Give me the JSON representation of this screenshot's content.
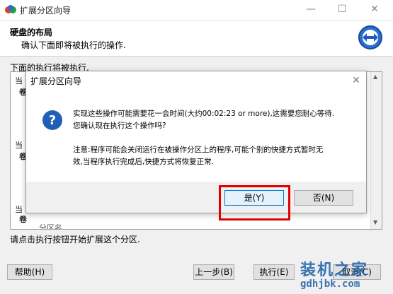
{
  "window": {
    "title": "扩展分区向导",
    "minimize": "—",
    "maximize": "☐",
    "close": "✕"
  },
  "header": {
    "title": "硬盘的布局",
    "subtitle": "确认下面即将被执行的操作."
  },
  "main": {
    "exec_label": "下面的执行将被执行.",
    "list_partial": [
      "当",
      "卷",
      "当",
      "卷",
      "当",
      "卷",
      "分区名"
    ],
    "footer_hint": "请点击执行按钮开始扩展这个分区."
  },
  "buttons": {
    "help": "帮助(H)",
    "back": "上一步(B)",
    "execute": "执行(E)",
    "cancel": "取消(C)"
  },
  "dialog": {
    "title": "扩展分区向导",
    "message_line1": "实现这些操作可能需要花一会时间(大约00:02:23 or more),这需要您耐心等待.",
    "message_line2": "您确认现在执行这个操作吗?",
    "note_line1": "注意:程序可能会关闭运行在被操作分区上的程序,可能个别的快捷方式暂时无",
    "note_line2": "效,当程序执行完成后,快捷方式将恢复正常.",
    "yes_label": "是(Y)",
    "no_label": "否(N)"
  },
  "watermark": {
    "text": "装机之家",
    "url": "gdhjbk.com"
  },
  "colors": {
    "accent": "#0078d7",
    "highlight": "#e00000",
    "question_icon": "#1f5fb5"
  }
}
